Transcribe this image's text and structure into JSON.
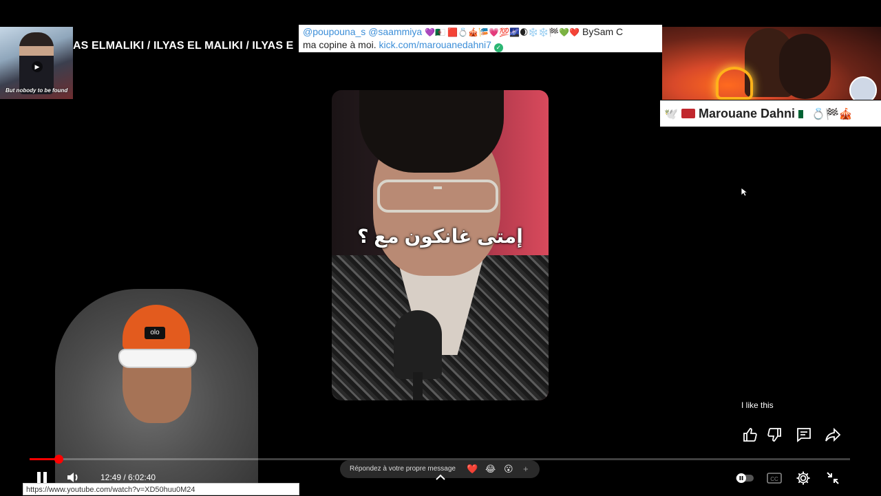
{
  "overlay_left": {
    "thumbnail_caption": "But nobody to be found",
    "marquee_text": "AS ELMALIKI / ILYAS EL MALIKI / ILYAS E"
  },
  "chat_banner": {
    "mention1": "@poupouna_s",
    "mention2": "@saammiya",
    "emoji_row": "💜🇩🇿 🟥💍🎪🎏💗💯🌌🌒❄️❄️🏁💚❤️",
    "suffix": "BySam C",
    "line2_text": "ma copine à moi.",
    "link": "kick.com/marouanedahni7",
    "verified_mark": "✓"
  },
  "channel": {
    "name": "Marouane Dahni",
    "leading_emoji": "🕊️",
    "trailing_emoji": "💍🏁🎪"
  },
  "video": {
    "subtitle": "إمتى غانكون مع ؟"
  },
  "player": {
    "current_time": "12:49",
    "duration": "6:02:40",
    "time_display": "12:49 / 6:02:40",
    "progress": 0.035,
    "status_url": "https://www.youtube.com/watch?v=XD50huu0M24",
    "cc_label": "CC"
  },
  "reply": {
    "placeholder": "Répondez à votre propre message",
    "emojis": [
      "❤️",
      "😂",
      "😮"
    ],
    "add": "+"
  },
  "side_actions": {
    "tooltip": "I like this"
  },
  "colors": {
    "accent": "#ff0000",
    "link": "#3b8ed8",
    "verified": "#2bb673"
  }
}
